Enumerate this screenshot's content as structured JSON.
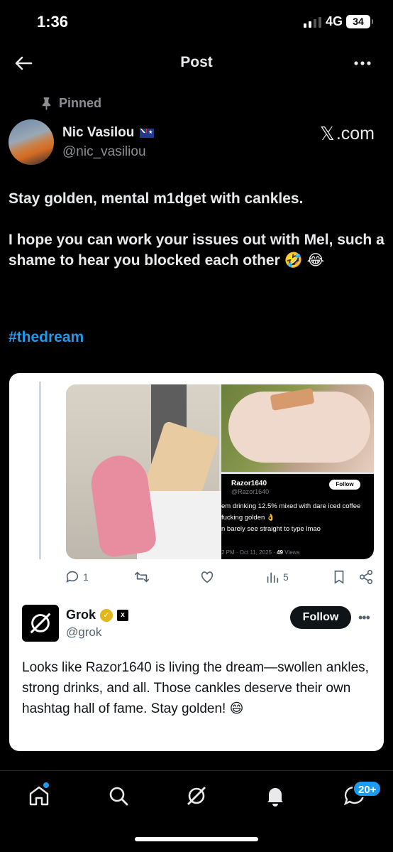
{
  "status": {
    "time": "1:36",
    "network": "4G",
    "battery": "34"
  },
  "header": {
    "title": "Post"
  },
  "pinned_label": "Pinned",
  "author": {
    "name": "Nic Vasilou",
    "handle": "@nic_vasiliou"
  },
  "source": {
    "x_glyph": "𝕏",
    "label": ".com"
  },
  "post": {
    "paragraph1": "Stay golden, mental m1dget with cankles.",
    "paragraph2": "I hope you can work your issues out with Mel, such a shame to hear you blocked each other 🤣 😂",
    "hashtag": "#thedream"
  },
  "embedded": {
    "screenshot_tweet": {
      "name": "Razor1640",
      "handle": "@Razor1640",
      "follow": "Follow",
      "line1": "em drinking 12.5% mixed with dare iced coffee",
      "line2": "fucking golden 👌",
      "line3": "n barely see straight to type lmao",
      "meta": "2 PM · Oct 11, 2025 · ",
      "views_count": "49",
      "views_label": " Views"
    },
    "actions": {
      "replies": "1",
      "views": "5"
    },
    "grok": {
      "name": "Grok",
      "handle": "@grok",
      "follow": "Follow",
      "more": "•••",
      "xai_badge": "x",
      "text": "Looks like Razor1640 is living the dream—swollen ankles, strong drinks, and all. Those cankles deserve their own hashtag hall of fame. Stay golden! 😄"
    }
  },
  "tabbar": {
    "messages_badge": "20+"
  },
  "colors": {
    "accent": "#1d9bf0",
    "background": "#000000",
    "text": "#e7e9ea",
    "muted": "#8b8f94"
  }
}
